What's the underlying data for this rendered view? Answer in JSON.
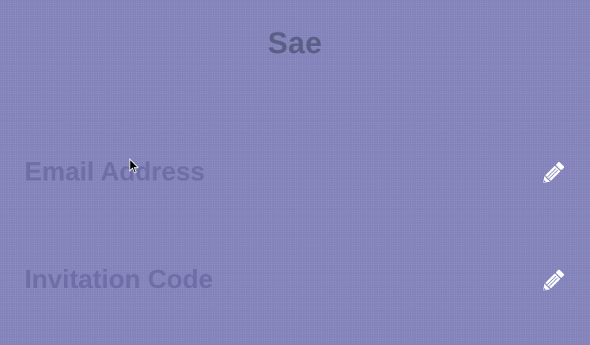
{
  "page": {
    "title": "Sae"
  },
  "rows": [
    {
      "label": "Email Address",
      "action_icon": "pencil-icon"
    },
    {
      "label": "Invitation Code",
      "action_icon": "pencil-icon"
    }
  ],
  "colors": {
    "background": "#8585bd",
    "title": "#5a5f86",
    "row_label": "#6f6ea6",
    "icon": "#ffffff"
  }
}
